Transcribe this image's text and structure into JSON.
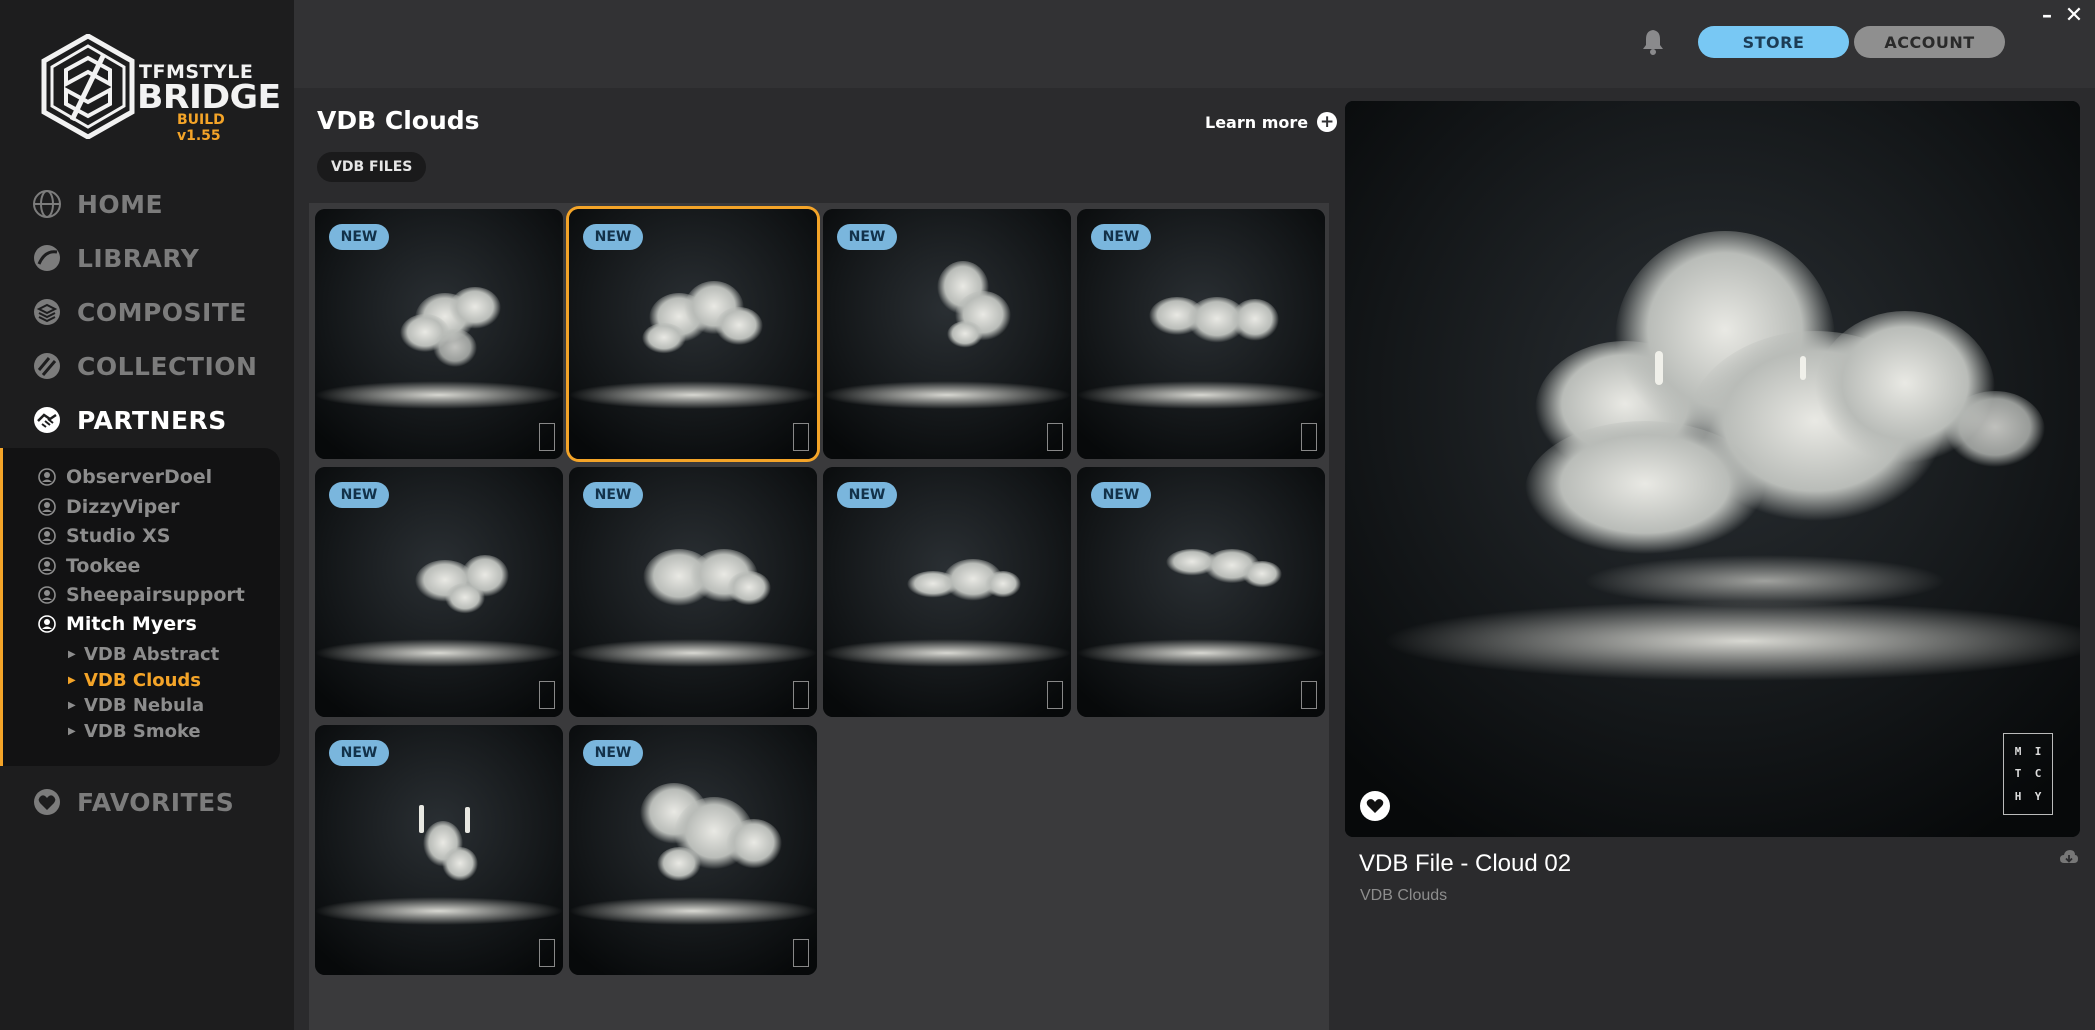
{
  "window": {
    "minimize_glyph": "–",
    "close_glyph": "✕"
  },
  "logo": {
    "line1": "TFMSTYLE",
    "line2": "BRIDGE",
    "build": "BUILD v1.55"
  },
  "nav": [
    {
      "label": "HOME",
      "icon": "globe-icon"
    },
    {
      "label": "LIBRARY",
      "icon": "library-ball-icon"
    },
    {
      "label": "COMPOSITE",
      "icon": "layers-icon"
    },
    {
      "label": "COLLECTION",
      "icon": "collection-stripes-icon"
    },
    {
      "label": "PARTNERS",
      "icon": "handshake-icon",
      "active": true
    }
  ],
  "partners": [
    "ObserverDoel",
    "DizzyViper",
    "Studio XS",
    "Tookee",
    "Sheepairsupport",
    "Mitch Myers"
  ],
  "active_partner": "Mitch Myers",
  "subcategories": [
    "VDB Abstract",
    "VDB Clouds",
    "VDB Nebula",
    "VDB Smoke"
  ],
  "active_subcategory": "VDB Clouds",
  "favorites": {
    "label": "FAVORITES",
    "icon": "heart-icon"
  },
  "topbar": {
    "store": "STORE",
    "account": "ACCOUNT",
    "bell_icon": "bell-icon"
  },
  "main": {
    "title": "VDB Clouds",
    "learn_more": "Learn more",
    "filter_chip": "VDB FILES"
  },
  "tiles": [
    {
      "badge": "NEW",
      "selected": false
    },
    {
      "badge": "NEW",
      "selected": true
    },
    {
      "badge": "NEW",
      "selected": false
    },
    {
      "badge": "NEW",
      "selected": false
    },
    {
      "badge": "NEW",
      "selected": false
    },
    {
      "badge": "NEW",
      "selected": false
    },
    {
      "badge": "NEW",
      "selected": false
    },
    {
      "badge": "NEW",
      "selected": false
    },
    {
      "badge": "NEW",
      "selected": false
    },
    {
      "badge": "NEW",
      "selected": false
    }
  ],
  "detail": {
    "title": "VDB File - Cloud 02",
    "category": "VDB Clouds",
    "brand_mark": [
      "M",
      "I",
      "T",
      "C",
      "H",
      "Y"
    ]
  },
  "colors": {
    "accent": "#f4a428",
    "store": "#78c8f4",
    "badge": "#7ab6dd"
  }
}
